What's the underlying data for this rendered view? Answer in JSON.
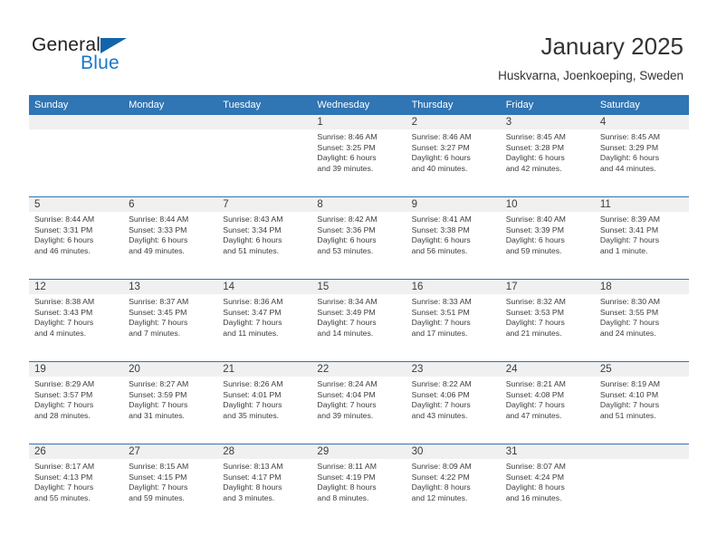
{
  "brand": {
    "name_part1": "General",
    "name_part2": "Blue",
    "color_dark": "#231f20",
    "color_blue": "#1878c8"
  },
  "header": {
    "title": "January 2025",
    "subtitle": "Huskvarna, Joenkoeping, Sweden",
    "accent_color": "#3075b4"
  },
  "calendar": {
    "weekday_headers": [
      "Sunday",
      "Monday",
      "Tuesday",
      "Wednesday",
      "Thursday",
      "Friday",
      "Saturday"
    ],
    "weeks": [
      [
        {
          "day": "",
          "sunrise": "",
          "sunset": "",
          "daylight1": "",
          "daylight2": ""
        },
        {
          "day": "",
          "sunrise": "",
          "sunset": "",
          "daylight1": "",
          "daylight2": ""
        },
        {
          "day": "",
          "sunrise": "",
          "sunset": "",
          "daylight1": "",
          "daylight2": ""
        },
        {
          "day": "1",
          "sunrise": "Sunrise: 8:46 AM",
          "sunset": "Sunset: 3:25 PM",
          "daylight1": "Daylight: 6 hours",
          "daylight2": "and 39 minutes."
        },
        {
          "day": "2",
          "sunrise": "Sunrise: 8:46 AM",
          "sunset": "Sunset: 3:27 PM",
          "daylight1": "Daylight: 6 hours",
          "daylight2": "and 40 minutes."
        },
        {
          "day": "3",
          "sunrise": "Sunrise: 8:45 AM",
          "sunset": "Sunset: 3:28 PM",
          "daylight1": "Daylight: 6 hours",
          "daylight2": "and 42 minutes."
        },
        {
          "day": "4",
          "sunrise": "Sunrise: 8:45 AM",
          "sunset": "Sunset: 3:29 PM",
          "daylight1": "Daylight: 6 hours",
          "daylight2": "and 44 minutes."
        }
      ],
      [
        {
          "day": "5",
          "sunrise": "Sunrise: 8:44 AM",
          "sunset": "Sunset: 3:31 PM",
          "daylight1": "Daylight: 6 hours",
          "daylight2": "and 46 minutes."
        },
        {
          "day": "6",
          "sunrise": "Sunrise: 8:44 AM",
          "sunset": "Sunset: 3:33 PM",
          "daylight1": "Daylight: 6 hours",
          "daylight2": "and 49 minutes."
        },
        {
          "day": "7",
          "sunrise": "Sunrise: 8:43 AM",
          "sunset": "Sunset: 3:34 PM",
          "daylight1": "Daylight: 6 hours",
          "daylight2": "and 51 minutes."
        },
        {
          "day": "8",
          "sunrise": "Sunrise: 8:42 AM",
          "sunset": "Sunset: 3:36 PM",
          "daylight1": "Daylight: 6 hours",
          "daylight2": "and 53 minutes."
        },
        {
          "day": "9",
          "sunrise": "Sunrise: 8:41 AM",
          "sunset": "Sunset: 3:38 PM",
          "daylight1": "Daylight: 6 hours",
          "daylight2": "and 56 minutes."
        },
        {
          "day": "10",
          "sunrise": "Sunrise: 8:40 AM",
          "sunset": "Sunset: 3:39 PM",
          "daylight1": "Daylight: 6 hours",
          "daylight2": "and 59 minutes."
        },
        {
          "day": "11",
          "sunrise": "Sunrise: 8:39 AM",
          "sunset": "Sunset: 3:41 PM",
          "daylight1": "Daylight: 7 hours",
          "daylight2": "and 1 minute."
        }
      ],
      [
        {
          "day": "12",
          "sunrise": "Sunrise: 8:38 AM",
          "sunset": "Sunset: 3:43 PM",
          "daylight1": "Daylight: 7 hours",
          "daylight2": "and 4 minutes."
        },
        {
          "day": "13",
          "sunrise": "Sunrise: 8:37 AM",
          "sunset": "Sunset: 3:45 PM",
          "daylight1": "Daylight: 7 hours",
          "daylight2": "and 7 minutes."
        },
        {
          "day": "14",
          "sunrise": "Sunrise: 8:36 AM",
          "sunset": "Sunset: 3:47 PM",
          "daylight1": "Daylight: 7 hours",
          "daylight2": "and 11 minutes."
        },
        {
          "day": "15",
          "sunrise": "Sunrise: 8:34 AM",
          "sunset": "Sunset: 3:49 PM",
          "daylight1": "Daylight: 7 hours",
          "daylight2": "and 14 minutes."
        },
        {
          "day": "16",
          "sunrise": "Sunrise: 8:33 AM",
          "sunset": "Sunset: 3:51 PM",
          "daylight1": "Daylight: 7 hours",
          "daylight2": "and 17 minutes."
        },
        {
          "day": "17",
          "sunrise": "Sunrise: 8:32 AM",
          "sunset": "Sunset: 3:53 PM",
          "daylight1": "Daylight: 7 hours",
          "daylight2": "and 21 minutes."
        },
        {
          "day": "18",
          "sunrise": "Sunrise: 8:30 AM",
          "sunset": "Sunset: 3:55 PM",
          "daylight1": "Daylight: 7 hours",
          "daylight2": "and 24 minutes."
        }
      ],
      [
        {
          "day": "19",
          "sunrise": "Sunrise: 8:29 AM",
          "sunset": "Sunset: 3:57 PM",
          "daylight1": "Daylight: 7 hours",
          "daylight2": "and 28 minutes."
        },
        {
          "day": "20",
          "sunrise": "Sunrise: 8:27 AM",
          "sunset": "Sunset: 3:59 PM",
          "daylight1": "Daylight: 7 hours",
          "daylight2": "and 31 minutes."
        },
        {
          "day": "21",
          "sunrise": "Sunrise: 8:26 AM",
          "sunset": "Sunset: 4:01 PM",
          "daylight1": "Daylight: 7 hours",
          "daylight2": "and 35 minutes."
        },
        {
          "day": "22",
          "sunrise": "Sunrise: 8:24 AM",
          "sunset": "Sunset: 4:04 PM",
          "daylight1": "Daylight: 7 hours",
          "daylight2": "and 39 minutes."
        },
        {
          "day": "23",
          "sunrise": "Sunrise: 8:22 AM",
          "sunset": "Sunset: 4:06 PM",
          "daylight1": "Daylight: 7 hours",
          "daylight2": "and 43 minutes."
        },
        {
          "day": "24",
          "sunrise": "Sunrise: 8:21 AM",
          "sunset": "Sunset: 4:08 PM",
          "daylight1": "Daylight: 7 hours",
          "daylight2": "and 47 minutes."
        },
        {
          "day": "25",
          "sunrise": "Sunrise: 8:19 AM",
          "sunset": "Sunset: 4:10 PM",
          "daylight1": "Daylight: 7 hours",
          "daylight2": "and 51 minutes."
        }
      ],
      [
        {
          "day": "26",
          "sunrise": "Sunrise: 8:17 AM",
          "sunset": "Sunset: 4:13 PM",
          "daylight1": "Daylight: 7 hours",
          "daylight2": "and 55 minutes."
        },
        {
          "day": "27",
          "sunrise": "Sunrise: 8:15 AM",
          "sunset": "Sunset: 4:15 PM",
          "daylight1": "Daylight: 7 hours",
          "daylight2": "and 59 minutes."
        },
        {
          "day": "28",
          "sunrise": "Sunrise: 8:13 AM",
          "sunset": "Sunset: 4:17 PM",
          "daylight1": "Daylight: 8 hours",
          "daylight2": "and 3 minutes."
        },
        {
          "day": "29",
          "sunrise": "Sunrise: 8:11 AM",
          "sunset": "Sunset: 4:19 PM",
          "daylight1": "Daylight: 8 hours",
          "daylight2": "and 8 minutes."
        },
        {
          "day": "30",
          "sunrise": "Sunrise: 8:09 AM",
          "sunset": "Sunset: 4:22 PM",
          "daylight1": "Daylight: 8 hours",
          "daylight2": "and 12 minutes."
        },
        {
          "day": "31",
          "sunrise": "Sunrise: 8:07 AM",
          "sunset": "Sunset: 4:24 PM",
          "daylight1": "Daylight: 8 hours",
          "daylight2": "and 16 minutes."
        },
        {
          "day": "",
          "sunrise": "",
          "sunset": "",
          "daylight1": "",
          "daylight2": ""
        }
      ]
    ]
  }
}
